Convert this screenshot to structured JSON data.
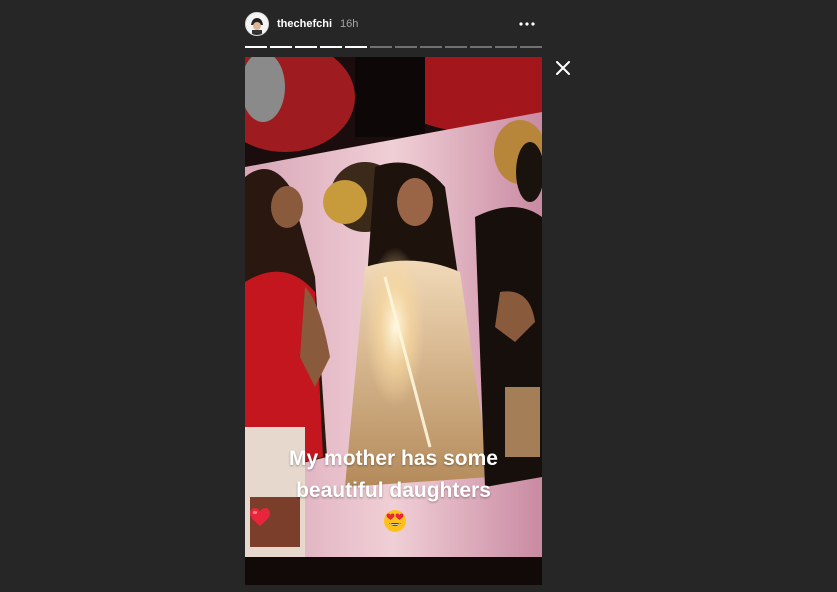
{
  "story": {
    "username": "thechefchi",
    "timestamp": "16h",
    "progress": {
      "total": 12,
      "completed": 5
    },
    "caption": {
      "line1": "My mother has some",
      "line2": "beautiful daughters",
      "heart_icon": "red-heart-icon",
      "emoji_icon": "heart-eyes-emoji-icon"
    }
  },
  "icons": {
    "more": "more-horizontal-icon",
    "close": "close-icon"
  },
  "colors": {
    "background": "#262626",
    "text": "#ffffff",
    "muted_text": "#a8a8a8",
    "heart": "#e8253b"
  }
}
